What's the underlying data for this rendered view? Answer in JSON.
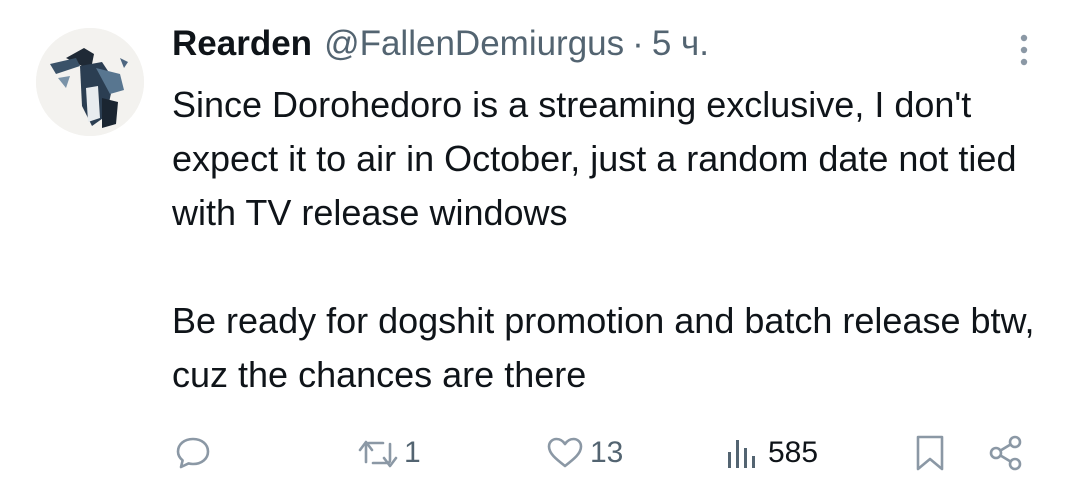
{
  "author": {
    "display_name": "Rearden",
    "handle": "@FallenDemiurgus",
    "separator": "·",
    "time": "5 ч."
  },
  "tweet": {
    "paragraphs": [
      "Since Dorohedoro is a streaming exclusive, I don't expect it to air in October, just a random date not tied with TV release windows",
      "Be ready for dogshit promotion and batch release btw, cuz the chances are there"
    ]
  },
  "actions": {
    "reply": {
      "icon": "reply-icon",
      "count": ""
    },
    "retweet": {
      "icon": "retweet-icon",
      "count": "1"
    },
    "like": {
      "icon": "heart-icon",
      "count": "13"
    },
    "views": {
      "icon": "views-chart-icon",
      "count": "585"
    },
    "bookmark": {
      "icon": "bookmark-icon"
    },
    "share": {
      "icon": "share-icon"
    }
  },
  "colors": {
    "text": "#0f1419",
    "secondary": "#536471",
    "icon_muted": "#8b98a5",
    "background": "#ffffff"
  }
}
